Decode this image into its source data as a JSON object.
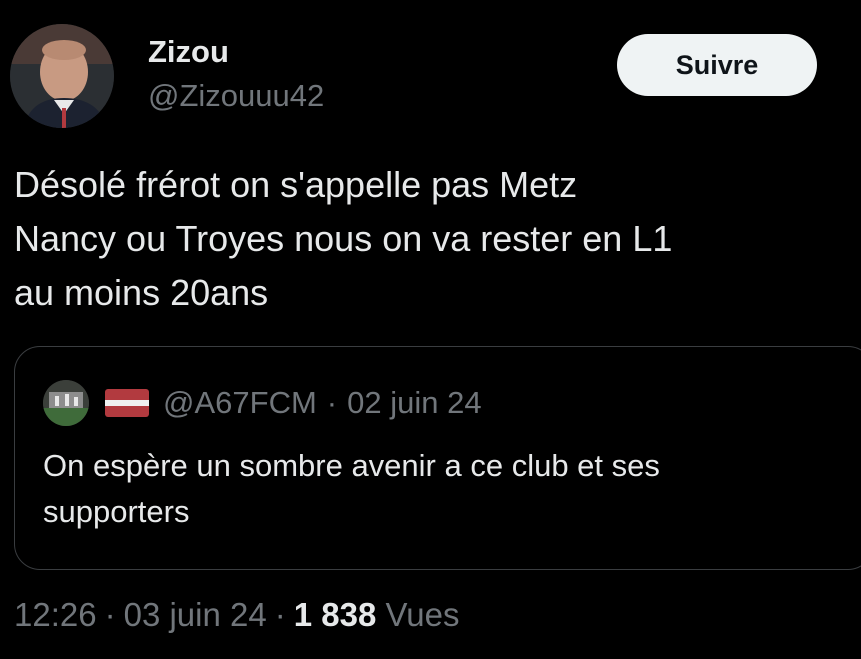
{
  "author": {
    "display_name": "Zizou",
    "handle": "@Zizouuu42",
    "avatar_icon": "profile-photo-avatar"
  },
  "header": {
    "follow_label": "Suivre",
    "more_icon": "more-vertical-icon"
  },
  "tweet": {
    "text_lines": [
      "Désolé frérot on s'appelle pas Metz",
      "Nancy ou Troyes nous on va rester en L1",
      "au moins 20ans"
    ]
  },
  "quoted_tweet": {
    "flag_icon": "latvia-flag-icon",
    "handle": "@A67FCM",
    "separator": "·",
    "date": "02 juin 24",
    "text_lines": [
      "On espère un sombre avenir a ce club et ses",
      "supporters"
    ]
  },
  "meta": {
    "time": "12:26",
    "separator": "·",
    "date": "03 juin 24",
    "views_count": "1 838",
    "views_label": "Vues"
  },
  "colors": {
    "background": "#000000",
    "primary_text": "#e7e9ea",
    "secondary_text": "#71767b",
    "follow_button_bg": "#eff3f4",
    "border": "#3a3d40"
  }
}
